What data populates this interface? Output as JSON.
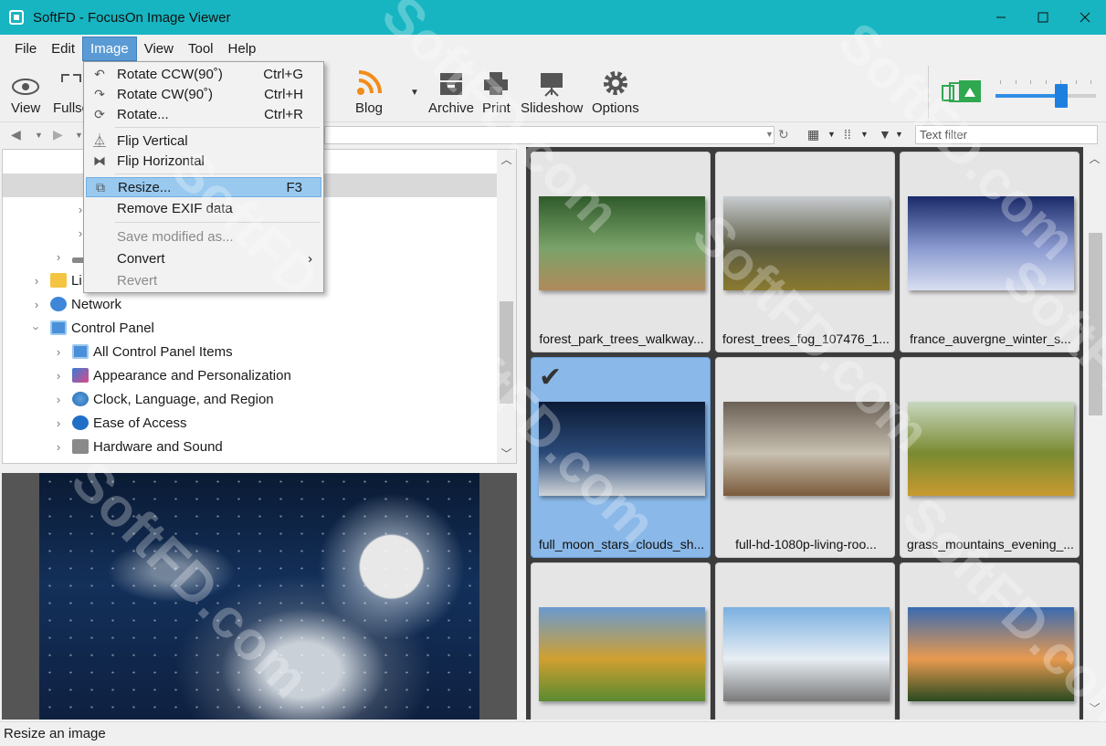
{
  "window": {
    "title": "SoftFD - FocusOn Image Viewer"
  },
  "menubar": {
    "items": [
      "File",
      "Edit",
      "Image",
      "View",
      "Tool",
      "Help"
    ],
    "active": "Image"
  },
  "toolbar": {
    "view": "View",
    "fullscreen": "Fullsc",
    "blog": "Blog",
    "archive": "Archive",
    "print": "Print",
    "slideshow": "Slideshow",
    "options": "Options"
  },
  "zoom": {
    "level": 0.65
  },
  "navbar": {
    "filter_placeholder": "Text filter"
  },
  "tree": {
    "items": [
      {
        "label": "Libraries",
        "visible": "Li"
      },
      {
        "label": "Network"
      },
      {
        "label": "Control Panel"
      },
      {
        "label": "All Control Panel Items"
      },
      {
        "label": "Appearance and Personalization"
      },
      {
        "label": "Clock, Language, and Region"
      },
      {
        "label": "Ease of Access"
      },
      {
        "label": "Hardware and Sound"
      }
    ]
  },
  "image_menu": {
    "items": [
      {
        "label": "Rotate CCW(90˚)",
        "shortcut": "Ctrl+G",
        "icon": "rotate-ccw-icon"
      },
      {
        "label": "Rotate CW(90˚)",
        "shortcut": "Ctrl+H",
        "icon": "rotate-cw-icon"
      },
      {
        "label": "Rotate...",
        "shortcut": "Ctrl+R",
        "icon": "rotate-icon"
      },
      {
        "label": "Flip Vertical",
        "shortcut": "",
        "icon": "flip-vertical-icon"
      },
      {
        "label": "Flip Horizontal",
        "shortcut": "",
        "icon": "flip-horizontal-icon"
      },
      {
        "label": "Resize...",
        "shortcut": "F3",
        "icon": "resize-icon"
      },
      {
        "label": "Remove EXIF data",
        "shortcut": ""
      },
      {
        "label": "Save modified as...",
        "shortcut": ""
      },
      {
        "label": "Convert",
        "shortcut": ""
      },
      {
        "label": "Revert",
        "shortcut": ""
      }
    ]
  },
  "thumbnails": [
    {
      "caption": "forest_park_trees_walkway...",
      "colors": [
        "#2f5a2a",
        "#7aa36a",
        "#b08a5a"
      ]
    },
    {
      "caption": "forest_trees_fog_107476_1...",
      "colors": [
        "#c8ccd0",
        "#5a5a40",
        "#8a7a30"
      ]
    },
    {
      "caption": "france_auvergne_winter_s...",
      "colors": [
        "#1a2a6a",
        "#8a9ad0",
        "#d8dff0"
      ]
    },
    {
      "caption": "full_moon_stars_clouds_sh...",
      "colors": [
        "#0b1a35",
        "#2b4a78",
        "#d0d4d8"
      ]
    },
    {
      "caption": "full-hd-1080p-living-roo...",
      "colors": [
        "#6a6055",
        "#c8c0b0",
        "#7a5a3a"
      ]
    },
    {
      "caption": "grass_mountains_evening_...",
      "colors": [
        "#c8d8c0",
        "#7a8a30",
        "#c89a30"
      ]
    },
    {
      "caption": "",
      "colors": [
        "#6a9ad0",
        "#d0a030",
        "#5a8a30"
      ]
    },
    {
      "caption": "",
      "colors": [
        "#7ab0e0",
        "#e8eef4",
        "#7a7a7a"
      ]
    },
    {
      "caption": "",
      "colors": [
        "#3a6ab0",
        "#e89a50",
        "#2a4a20"
      ]
    }
  ],
  "status": {
    "text": "Resize an image"
  },
  "watermark": "SoftFD.com"
}
